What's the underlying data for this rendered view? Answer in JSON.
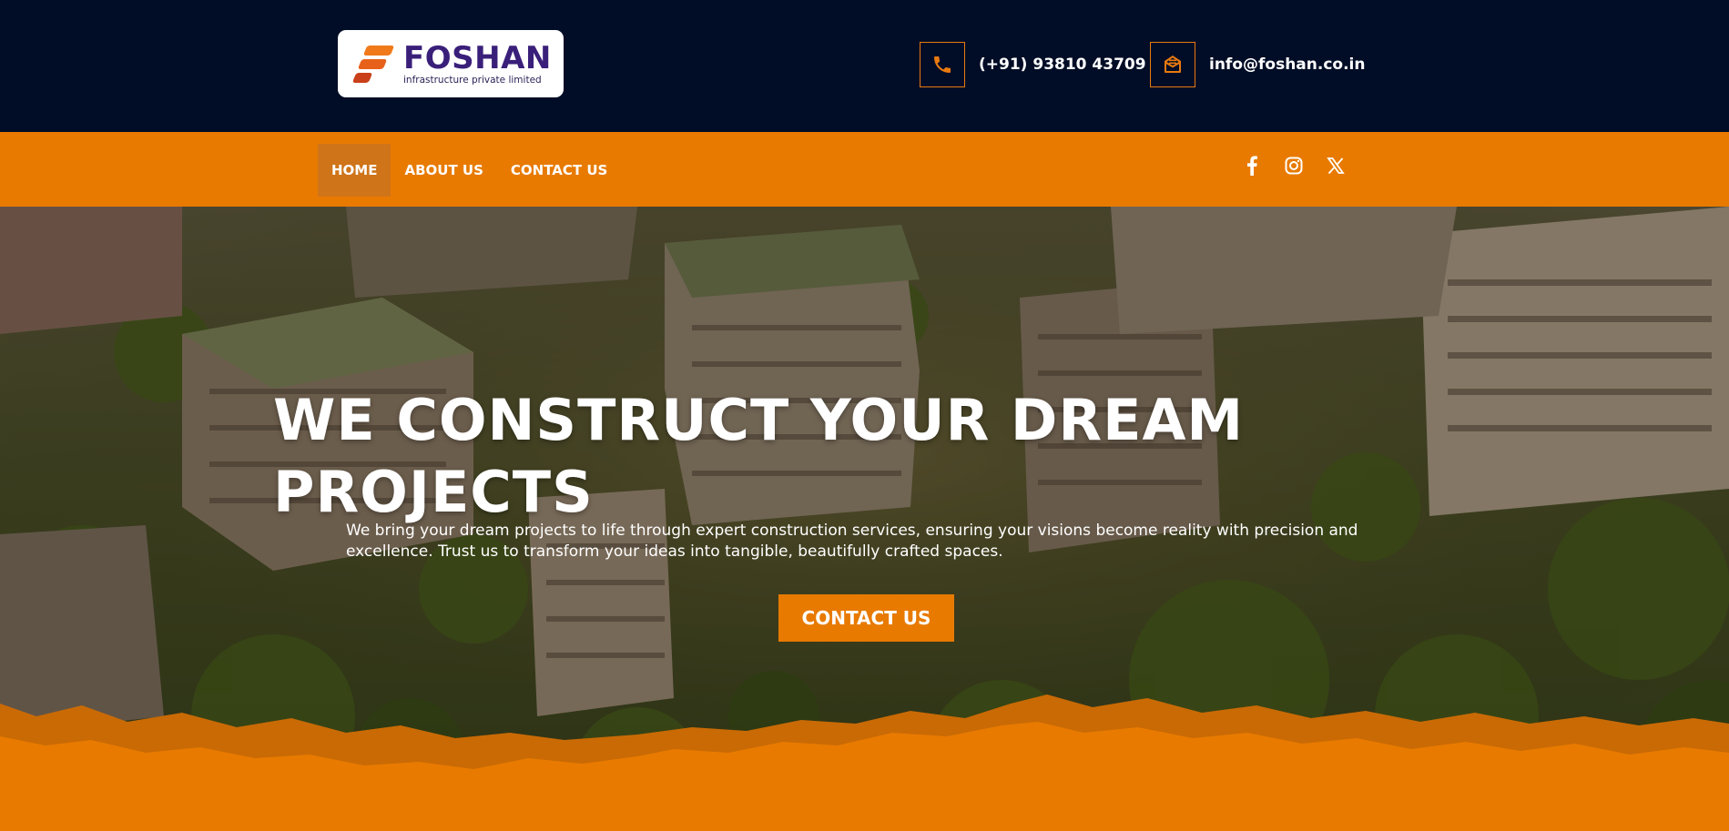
{
  "brand": {
    "name": "FOSHAN",
    "tagline": "infrastructure private limited"
  },
  "contact": {
    "phone": "(+91) 93810 43709",
    "email": "info@foshan.co.in",
    "phone_icon": "phone-icon",
    "email_icon": "envelope-open-icon"
  },
  "nav": {
    "items": [
      {
        "label": "HOME",
        "active": true
      },
      {
        "label": "ABOUT US",
        "active": false
      },
      {
        "label": "CONTACT US",
        "active": false
      }
    ],
    "socials": [
      "facebook-icon",
      "instagram-icon",
      "x-twitter-icon"
    ]
  },
  "hero": {
    "title": "WE CONSTRUCT YOUR DREAM PROJECTS",
    "subtitle": "We bring your dream projects to life through expert construction services, ensuring your visions become reality with precision and excellence. Trust us to transform your ideas into tangible, beautifully crafted spaces.",
    "cta_label": "CONTACT US"
  },
  "colors": {
    "header_bg": "#010d26",
    "accent": "#e87a00",
    "active_nav": "#cf7419",
    "text": "#ffffff"
  }
}
